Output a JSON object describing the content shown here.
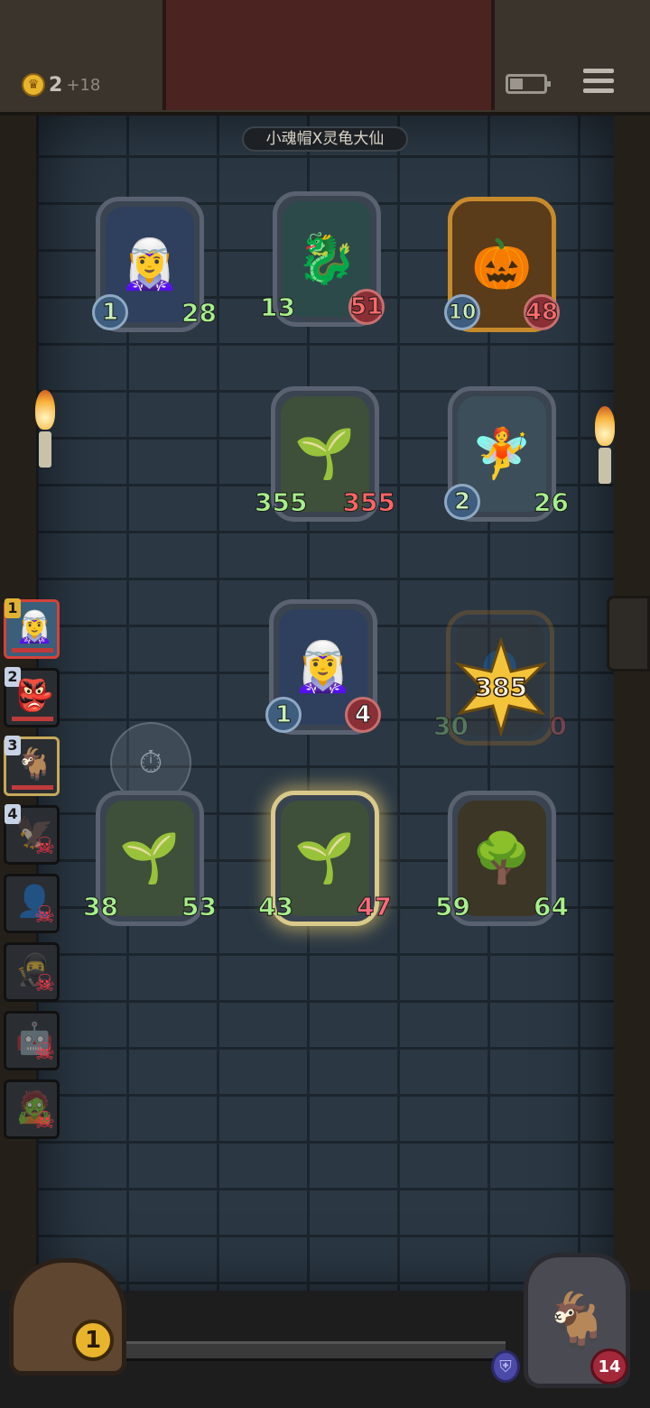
{
  "header": {
    "gold": "2",
    "gold_income": "+18",
    "matchup_title": "小魂帽X灵龟大仙"
  },
  "enemy_board": [
    {
      "name": "Elf Sorceress",
      "attack": "1",
      "health": "28"
    },
    {
      "name": "Stone Gargoyle",
      "attack": "13",
      "health": "51"
    },
    {
      "name": "Pumpkin Minion",
      "attack": "10",
      "health": "48"
    },
    {
      "name": "Leaf Sprout",
      "attack": "355",
      "health": "355"
    },
    {
      "name": "Fairy",
      "attack": "2",
      "health": "26"
    }
  ],
  "player_board": [
    {
      "name": "Elf Sorceress",
      "attack": "1",
      "health": "4"
    },
    {
      "name": "Shadow Minion",
      "attack": "30",
      "health": "0"
    },
    {
      "name": "Leaf Sprout",
      "attack": "38",
      "health": "53"
    },
    {
      "name": "Leaf Sprout",
      "attack": "43",
      "health": "47"
    },
    {
      "name": "Treant",
      "attack": "59",
      "health": "64"
    }
  ],
  "damage_burst": "385",
  "side_list": [
    {
      "rank": "1",
      "state": "active"
    },
    {
      "rank": "2",
      "state": "alive"
    },
    {
      "rank": "3",
      "state": "alive"
    },
    {
      "rank": "4",
      "state": "dead"
    },
    {
      "rank": "",
      "state": "dead"
    },
    {
      "rank": "",
      "state": "dead"
    },
    {
      "rank": "",
      "state": "dead"
    },
    {
      "rank": "",
      "state": "dead"
    }
  ],
  "bottom": {
    "chest_count": "1",
    "hero_health": "14"
  },
  "icons": {
    "gold": "coin-icon",
    "battery": "battery-icon",
    "menu": "menu-icon",
    "dead": "skull-icon",
    "armor": "shield-icon"
  }
}
